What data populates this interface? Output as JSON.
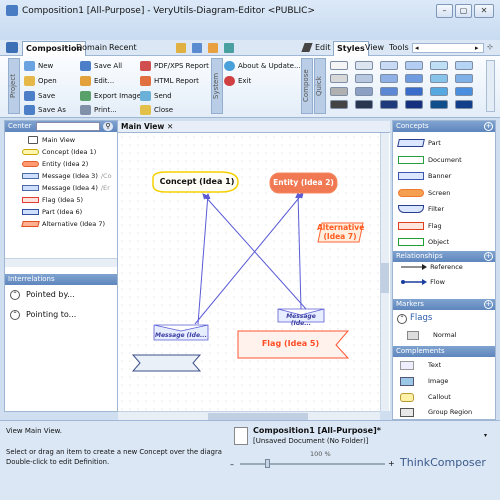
{
  "window": {
    "title": "Composition1 [All-Purpose] - VeryUtils-Diagram-Editor <PUBLIC>",
    "min": "–",
    "max": "▢",
    "close": "✕"
  },
  "tabs": {
    "composition": "Composition",
    "domain": "Domain",
    "recent": "Recent",
    "edit": "Edit",
    "styles": "Styles",
    "view": "View",
    "tools": "Tools"
  },
  "ribbon": {
    "group_project": "Project",
    "group_composition": "Composition",
    "group_system": "System",
    "group_compose": "Compose",
    "group_quick": "Quick",
    "new": "New",
    "open": "Open",
    "save": "Save",
    "save_as": "Save As",
    "save_all": "Save All",
    "edit": "Edit...",
    "export_image": "Export Image",
    "print": "Print...",
    "pdf_report": "PDF/XPS Report",
    "html_report": "HTML Report",
    "send": "Send",
    "close": "Close",
    "about": "About & Update...",
    "exit": "Exit"
  },
  "left": {
    "header": "Center",
    "search_placeholder": "",
    "items": [
      "Main View",
      "Concept (Idea 1)",
      "Entity (Idea 2)",
      "Message (Idea 3)",
      "Message (Idea 4)",
      "Flag (Idea 5)",
      "Part (Idea 6)",
      "Alternative (Idea 7)"
    ],
    "item3_suffix": "/Co",
    "item4_suffix": "/Er",
    "interrelations": "Interrelations",
    "pointed_by": "Pointed by...",
    "pointing_to": "Pointing to..."
  },
  "canvas": {
    "tab": "Main View",
    "tab_close": "✕",
    "concept": "Concept (Idea 1)",
    "entity": "Entity (Idea 2)",
    "alternative_l1": "Alternative",
    "alternative_l2": "(Idea 7)",
    "message1": "Message (Ide...",
    "message2": "Message (Ide...",
    "flag": "Flag (Idea 5)"
  },
  "right": {
    "concepts": "Concepts",
    "concept_items": [
      "Part",
      "Document",
      "Banner",
      "Screen",
      "Filter",
      "Flag",
      "Object"
    ],
    "relationships": "Relationships",
    "rel_items": [
      "Reference",
      "Flow"
    ],
    "markers": "Markers",
    "flags": "Flags",
    "normal": "Normal",
    "complements": "Complements",
    "comp_items": [
      "Text",
      "Image",
      "Callout",
      "Group Region"
    ]
  },
  "status": {
    "line1": "View Main View.",
    "line2": "Select or drag an item to create a new Concept over the diagra",
    "line3": "Double-click to edit Definition.",
    "doc_title": "Composition1 [All-Purpose]*",
    "doc_sub": "[Unsaved Document (No Folder)]",
    "zoom": "100 %",
    "brand": "ThinkComposer"
  },
  "colors": {
    "accent": "#5e86bd",
    "concept": "#f5d000",
    "entity": "#ef7a4f",
    "alternative": "#ff6633",
    "flag": "#ff5533",
    "edge": "#5b5bd6"
  }
}
